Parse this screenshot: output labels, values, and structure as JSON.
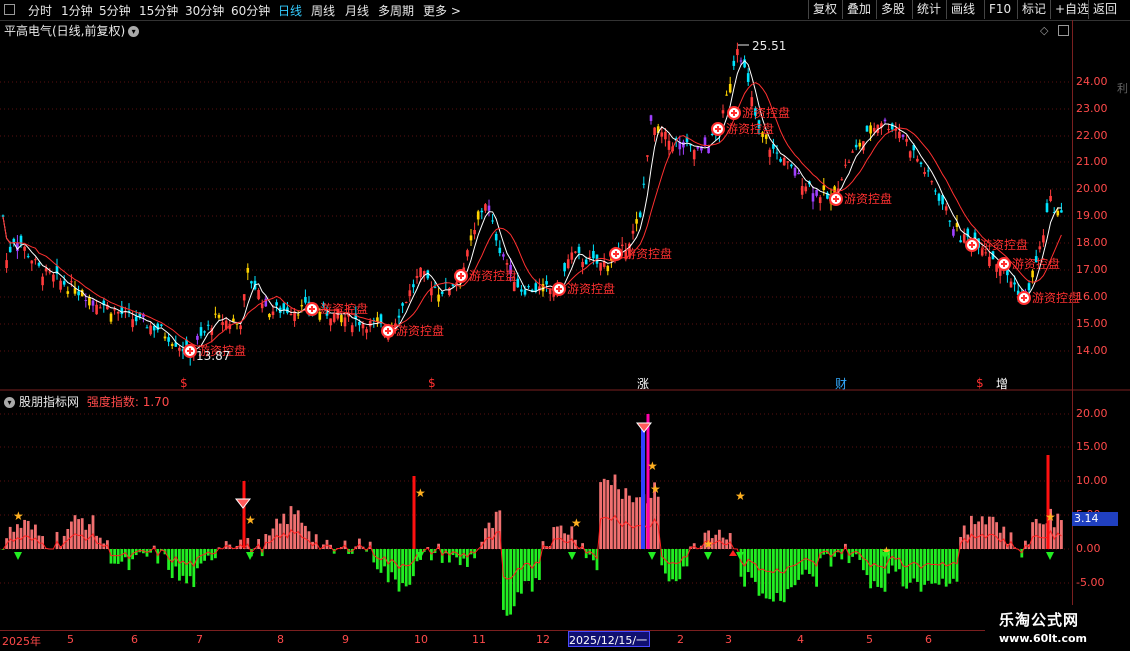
{
  "toolbar": {
    "tabs": [
      "分时",
      "1分钟",
      "5分钟",
      "15分钟",
      "30分钟",
      "60分钟",
      "日线",
      "周线",
      "月线",
      "多周期",
      "更多 >"
    ],
    "active_tab": "日线",
    "right_buttons": [
      "复权",
      "叠加",
      "多股",
      "统计",
      "画线",
      "F10",
      "标记",
      "+自选",
      "返回"
    ]
  },
  "main_chart": {
    "title": "平高电气(日线,前复权)",
    "high_label": "25.51",
    "low_label": "13.87",
    "signal_label": "游资控盘",
    "y_ticks": [
      "24.00",
      "23.00",
      "22.00",
      "21.00",
      "20.00",
      "19.00",
      "18.00",
      "17.00",
      "16.00",
      "15.00",
      "14.00"
    ],
    "event_marks": [
      "$",
      "$",
      "涨",
      "财",
      "$",
      "增"
    ],
    "colors": {
      "up": "#ff3b3b",
      "down": "#00e5ff",
      "ma5": "#ffffff",
      "ma10": "#ff3030",
      "signal": "#ff3030"
    }
  },
  "indicator": {
    "name": "股朋指标网",
    "label": "强度指数:",
    "value": "1.70",
    "y_ticks": [
      "20.00",
      "15.00",
      "10.00",
      "5.00",
      "0.00",
      "-5.00"
    ],
    "current_value": "3.14",
    "colors": {
      "positive": "#f07070",
      "negative": "#22ee22",
      "line": "#ff2020"
    }
  },
  "timeline": {
    "labels": [
      "2025年",
      "5",
      "6",
      "7",
      "8",
      "9",
      "10",
      "11",
      "12",
      "2",
      "3",
      "4",
      "5",
      "6"
    ],
    "selected": "2025/12/15/一"
  },
  "watermark": {
    "line1": "乐淘公式网",
    "line2": "www.60lt.com"
  },
  "side_text": "利"
}
